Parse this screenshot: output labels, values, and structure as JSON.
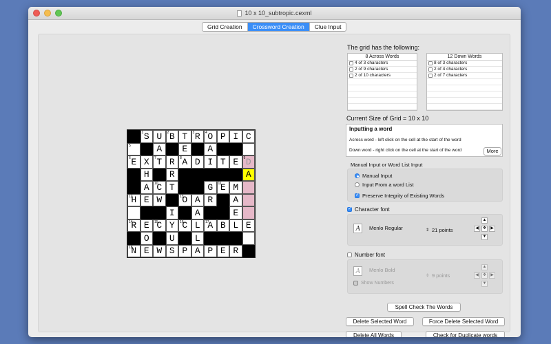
{
  "window": {
    "title": "10 x 10_subtropic.cexml"
  },
  "tabs": [
    "Grid Creation",
    "Crossword Creation",
    "Clue Input"
  ],
  "grid": {
    "rows": [
      [
        "#",
        "S",
        "U",
        "B",
        "T",
        "R",
        "O",
        "P",
        "I",
        "C"
      ],
      [
        "",
        "#",
        "A",
        "#",
        "E",
        "#",
        "A",
        "#",
        "#",
        ""
      ],
      [
        "E",
        "X",
        "T",
        "R",
        "A",
        "D",
        "I",
        "T",
        "E",
        "D"
      ],
      [
        "#",
        "H",
        "#",
        "R",
        "#",
        "#",
        "#",
        "#",
        "#",
        "A"
      ],
      [
        "#",
        "A",
        "C",
        "T",
        "#",
        "#",
        "G",
        "E",
        "M",
        ""
      ],
      [
        "H",
        "E",
        "W",
        "#",
        "O",
        "A",
        "R",
        "#",
        "A",
        ""
      ],
      [
        "",
        "#",
        "#",
        "I",
        "#",
        "A",
        "#",
        "#",
        "E",
        ""
      ],
      [
        "R",
        "E",
        "C",
        "Y",
        "C",
        "L",
        "A",
        "B",
        "L",
        "E"
      ],
      [
        "#",
        "O",
        "#",
        "U",
        "#",
        "L",
        "#",
        "#",
        "#",
        ""
      ],
      [
        "N",
        "E",
        "W",
        "S",
        "P",
        "A",
        "P",
        "E",
        "R",
        "#"
      ]
    ],
    "numbers": [
      [
        0,
        1,
        1,
        "1"
      ],
      [
        0,
        3,
        1,
        "2"
      ],
      [
        0,
        5,
        1,
        "3"
      ],
      [
        0,
        6,
        1,
        "4"
      ],
      [
        1,
        0,
        1,
        "5"
      ],
      [
        2,
        0,
        1,
        "6"
      ],
      [
        2,
        2,
        1,
        "7"
      ],
      [
        2,
        4,
        1,
        "8"
      ],
      [
        2,
        9,
        1,
        "9"
      ],
      [
        4,
        2,
        1,
        "10"
      ],
      [
        4,
        7,
        1,
        "11"
      ],
      [
        5,
        0,
        1,
        "12"
      ],
      [
        5,
        4,
        1,
        "13"
      ],
      [
        7,
        0,
        1,
        "14"
      ],
      [
        7,
        2,
        1,
        "15"
      ],
      [
        7,
        4,
        1,
        "16"
      ],
      [
        7,
        6,
        1,
        "17"
      ],
      [
        9,
        0,
        1,
        "18"
      ]
    ]
  },
  "word_summary": {
    "heading": "The grid has the following:",
    "across_title": "8 Across Words",
    "across": [
      "4 of 3 characters",
      "2 of 9 characters",
      "2 of 10 characters"
    ],
    "down_title": "12 Down Words",
    "down": [
      "8 of 3 characters",
      "2 of 4 characters",
      "2 of 7 characters"
    ]
  },
  "size_label": "Current Size of Grid = 10 x 10",
  "info": {
    "heading": "Inputting a word",
    "line1": "Across word - left click on the cell at the start of the word",
    "line2": "Down word - right click on the cell at the start of the word",
    "more": "More"
  },
  "input_mode": {
    "label": "Manual Input or Word List Input",
    "manual": "Manual Input",
    "wordlist": "Input From a word List",
    "preserve": "Preserve Integrity of Existing Words"
  },
  "char_font": {
    "label": "Character font",
    "name": "Menlo Regular",
    "size": "21 points"
  },
  "num_font": {
    "label": "Number font",
    "name": "Menlo Bold",
    "size": "9 points",
    "show": "Show Numbers"
  },
  "buttons": {
    "spell": "Spell Check The Words",
    "delete_selected": "Delete Selected Word",
    "force_delete": "Force Delete Selected Word",
    "delete_all": "Delete All Words",
    "check_dup": "Check for Duplicate words"
  }
}
